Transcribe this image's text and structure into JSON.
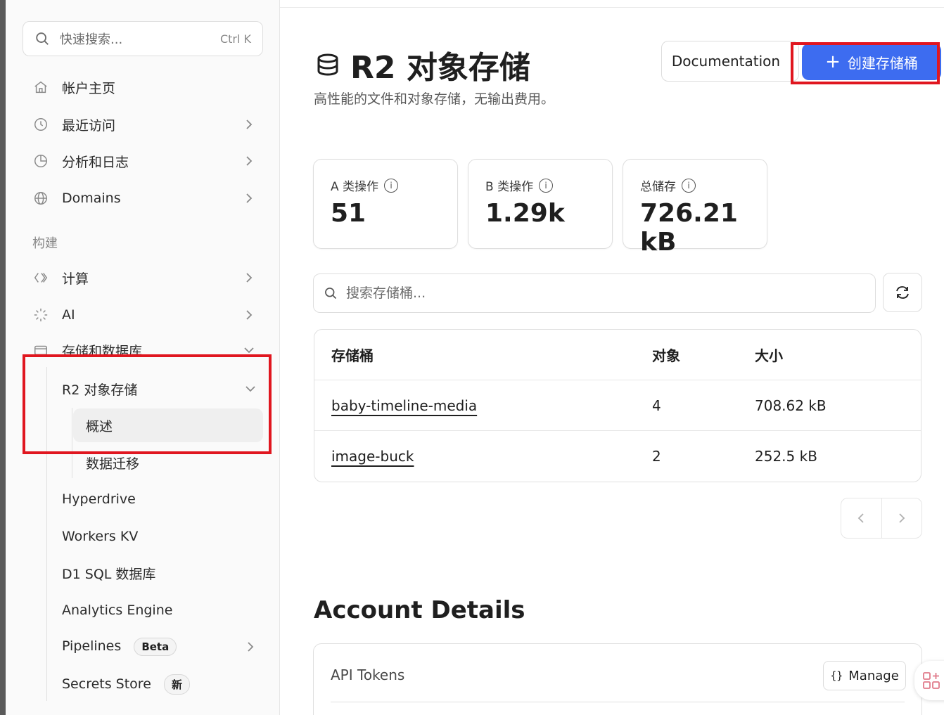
{
  "sidebar": {
    "search": {
      "placeholder": "快速搜索...",
      "shortcut": "Ctrl K"
    },
    "items": [
      {
        "label": "帐户主页",
        "icon": "home-icon",
        "chevron": false
      },
      {
        "label": "最近访问",
        "icon": "clock-icon",
        "chevron": true
      },
      {
        "label": "分析和日志",
        "icon": "chart-icon",
        "chevron": true
      },
      {
        "label": "Domains",
        "icon": "globe-icon",
        "chevron": true
      }
    ],
    "section_build": "构建",
    "build_items": [
      {
        "label": "计算",
        "icon": "compute-icon",
        "chevron": true
      },
      {
        "label": "AI",
        "icon": "sparkle-icon",
        "chevron": true
      },
      {
        "label": "存储和数据库",
        "icon": "database-icon",
        "chevron": true
      }
    ],
    "storage_children": {
      "r2": "R2 对象存储",
      "r2_children": [
        "概述",
        "数据迁移"
      ],
      "others": [
        {
          "label": "Hyperdrive"
        },
        {
          "label": "Workers KV"
        },
        {
          "label": "D1 SQL 数据库"
        },
        {
          "label": "Analytics Engine"
        },
        {
          "label": "Pipelines",
          "badge": "Beta"
        },
        {
          "label": "Secrets Store",
          "badge": "新"
        }
      ]
    }
  },
  "header": {
    "title": "R2 对象存储",
    "subtitle": "高性能的文件和对象存储，无输出费用。",
    "doc_button": "Documentation",
    "create_button": "创建存储桶"
  },
  "stats": [
    {
      "label": "A 类操作",
      "value": "51"
    },
    {
      "label": "B 类操作",
      "value": "1.29k"
    },
    {
      "label": "总储存",
      "value": "726.21 kB"
    }
  ],
  "bucket_search": {
    "placeholder": "搜索存储桶..."
  },
  "table": {
    "headers": [
      "存储桶",
      "对象",
      "大小"
    ],
    "rows": [
      {
        "name": "baby-timeline-media",
        "objects": "4",
        "size": "708.62 kB"
      },
      {
        "name": "image-buck",
        "objects": "2",
        "size": "252.5 kB"
      }
    ]
  },
  "account": {
    "heading": "Account Details",
    "api_tokens": "API Tokens",
    "manage_button": "Manage"
  },
  "colors": {
    "accent": "#3d6cf0",
    "highlight": "#e0161f"
  }
}
